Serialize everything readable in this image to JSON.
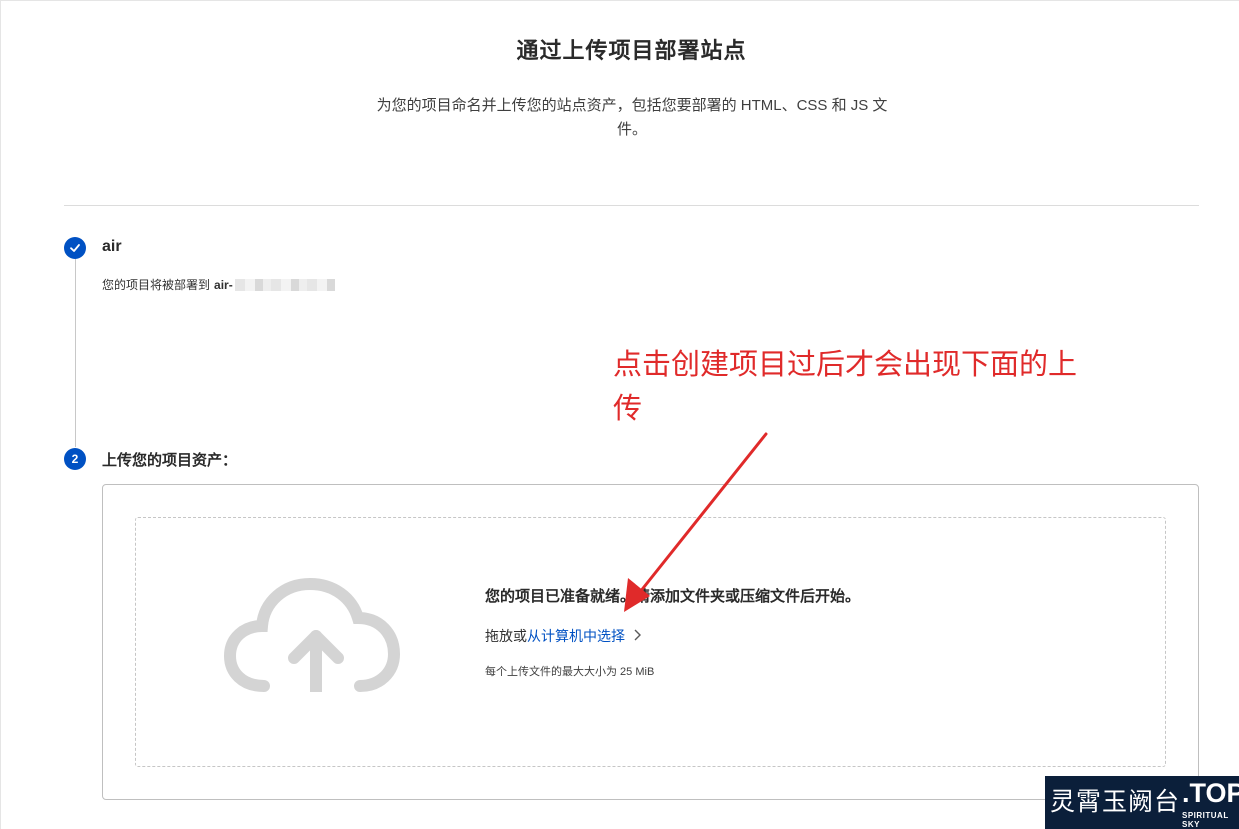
{
  "page": {
    "title": "通过上传项目部署站点",
    "subtitle": "为您的项目命名并上传您的站点资产，包括您要部署的 HTML、CSS 和 JS 文件。"
  },
  "step1": {
    "title": "air",
    "desc_prefix": "您的项目将被部署到",
    "domain_prefix": "air-",
    "status": "completed"
  },
  "step2": {
    "number": "2",
    "title": "上传您的项目资产："
  },
  "upload": {
    "ready_text": "您的项目已准备就绪。请添加文件夹或压缩文件后开始。",
    "drop_prefix": "拖放或",
    "select_link": "从计算机中选择",
    "limit_text": "每个上传文件的最大大小为 25 MiB"
  },
  "annotation": {
    "text": "点击创建项目过后才会出现下面的上传",
    "color": "#e02a2a"
  },
  "watermark": {
    "cn": "灵霄玉阙台",
    "dot_top": ".TOP",
    "sub": "SPIRITUAL SKY"
  },
  "colors": {
    "accent": "#0051c3",
    "annotation": "#e02a2a"
  }
}
